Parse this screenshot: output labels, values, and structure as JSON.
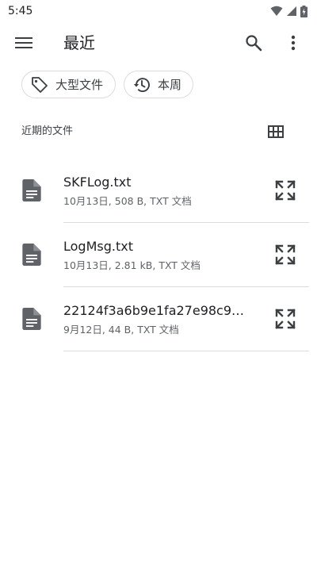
{
  "status": {
    "time": "5:45"
  },
  "appbar": {
    "title": "最近"
  },
  "chips": [
    {
      "label": "大型文件",
      "icon": "tag-icon"
    },
    {
      "label": "本周",
      "icon": "history-icon"
    }
  ],
  "section": {
    "title": "近期的文件"
  },
  "files": [
    {
      "name": "SKFLog.txt",
      "meta": "10月13日, 508 B, TXT 文档"
    },
    {
      "name": "LogMsg.txt",
      "meta": "10月13日, 2.81 kB, TXT 文档"
    },
    {
      "name": "22124f3a6b9e1fa27e98c9…",
      "meta": "9月12日, 44 B, TXT 文档"
    }
  ]
}
